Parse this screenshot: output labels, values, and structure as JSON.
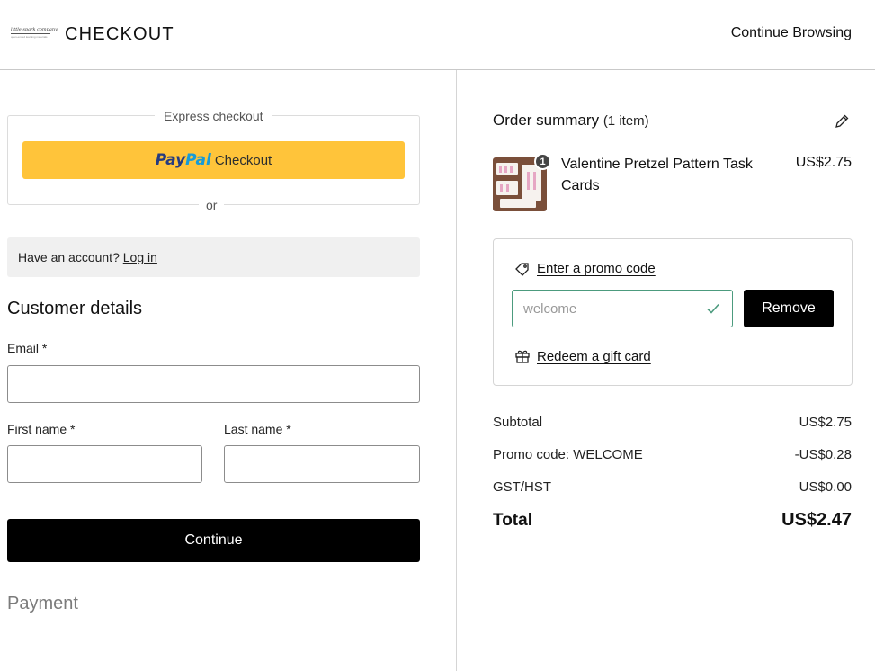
{
  "header": {
    "logo_line1": "little spark company",
    "logo_line2": "open-ended learning materials",
    "title": "CHECKOUT",
    "continue_browsing": "Continue Browsing"
  },
  "express": {
    "label": "Express checkout",
    "paypal_pay": "Pay",
    "paypal_pal": "Pal",
    "paypal_checkout": "Checkout",
    "or": "or"
  },
  "account": {
    "prompt": "Have an account?",
    "login": "Log in"
  },
  "customer": {
    "title": "Customer details",
    "email_label": "Email *",
    "email_value": "",
    "first_name_label": "First name *",
    "first_name_value": "",
    "last_name_label": "Last name *",
    "last_name_value": "",
    "continue_label": "Continue"
  },
  "payment": {
    "title": "Payment"
  },
  "summary": {
    "title": "Order summary",
    "count": "(1 item)",
    "edit_icon": "pencil-icon",
    "item": {
      "name": "Valentine Pretzel Pattern Task Cards",
      "price": "US$2.75",
      "quantity": "1"
    },
    "promo": {
      "link": "Enter a promo code",
      "value": "welcome",
      "remove_label": "Remove",
      "gift_link": "Redeem a gift card",
      "valid_color": "#4c9b7e"
    },
    "rows": [
      {
        "label": "Subtotal",
        "value": "US$2.75"
      },
      {
        "label": "Promo code: WELCOME",
        "value": "-US$0.28"
      },
      {
        "label": "GST/HST",
        "value": "US$0.00"
      }
    ],
    "total_label": "Total",
    "total_value": "US$2.47"
  },
  "colors": {
    "paypal_button": "#ffc43a",
    "paypal_pay": "#253b80",
    "paypal_pal": "#179bd7",
    "primary_button": "#000000",
    "account_box_bg": "#f0f0f0"
  }
}
